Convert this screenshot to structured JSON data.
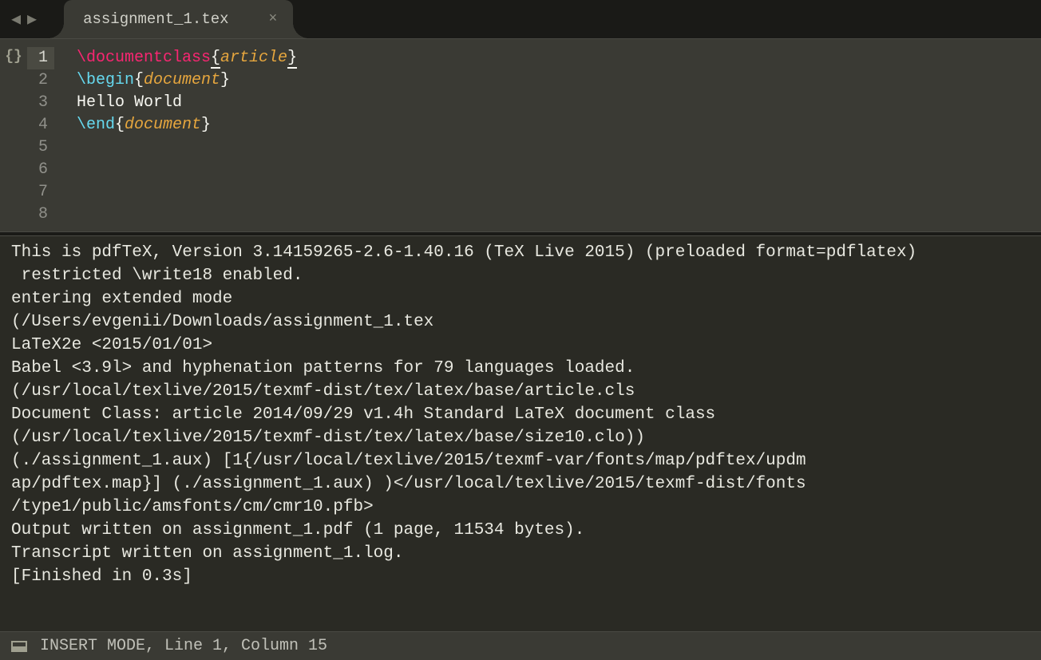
{
  "tab": {
    "filename": "assignment_1.tex",
    "close_glyph": "×"
  },
  "nav": {
    "back_glyph": "◀",
    "forward_glyph": "▶"
  },
  "gutter": {
    "brackets_glyph": "{}"
  },
  "editor": {
    "lines": {
      "n1": "1",
      "n2": "2",
      "n3": "3",
      "n4": "4",
      "n5": "5",
      "n6": "6",
      "n7": "7",
      "n8": "8"
    },
    "code": {
      "l1_cmd": "\\documentclass",
      "l1_arg": "article",
      "l3_cmd": "\\begin",
      "l3_arg": "document",
      "l5_text": "Hello World",
      "l7_cmd": "\\end",
      "l7_arg": "document",
      "brace_open": "{",
      "brace_close": "}"
    }
  },
  "console": {
    "output": "This is pdfTeX, Version 3.14159265-2.6-1.40.16 (TeX Live 2015) (preloaded format=pdflatex)\n restricted \\write18 enabled.\nentering extended mode\n(/Users/evgenii/Downloads/assignment_1.tex\nLaTeX2e <2015/01/01>\nBabel <3.9l> and hyphenation patterns for 79 languages loaded.\n(/usr/local/texlive/2015/texmf-dist/tex/latex/base/article.cls\nDocument Class: article 2014/09/29 v1.4h Standard LaTeX document class\n(/usr/local/texlive/2015/texmf-dist/tex/latex/base/size10.clo))\n(./assignment_1.aux) [1{/usr/local/texlive/2015/texmf-var/fonts/map/pdftex/updm\nap/pdftex.map}] (./assignment_1.aux) )</usr/local/texlive/2015/texmf-dist/fonts\n/type1/public/amsfonts/cm/cmr10.pfb>\nOutput written on assignment_1.pdf (1 page, 11534 bytes).\nTranscript written on assignment_1.log.\n[Finished in 0.3s]"
  },
  "status_bar": {
    "text": "INSERT MODE, Line 1, Column 15"
  }
}
